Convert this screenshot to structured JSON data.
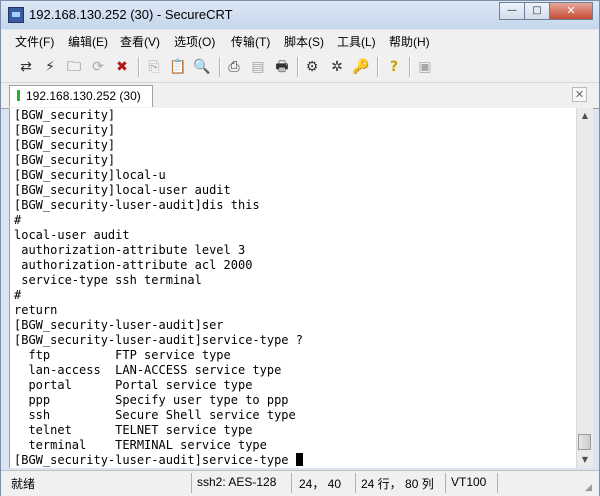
{
  "window": {
    "title": "192.168.130.252 (30) - SecureCRT",
    "buttons": {
      "minimize": "—",
      "maximize": "□",
      "close": "✕"
    }
  },
  "menu": [
    "文件(F)",
    "编辑(E)",
    "查看(V)",
    "选项(O)",
    "传输(T)",
    "脚本(S)",
    "工具(L)",
    "帮助(H)"
  ],
  "toolbar": [
    {
      "icon": "connect-icon",
      "glyph": "⇄"
    },
    {
      "icon": "quick-connect-icon",
      "glyph": "⚡"
    },
    {
      "icon": "connect-in-tab-icon",
      "glyph": "🗀"
    },
    {
      "icon": "reconnect-icon",
      "glyph": "⟳"
    },
    {
      "icon": "disconnect-icon",
      "glyph": "✖"
    },
    {
      "icon": "copy-icon",
      "glyph": "⎘"
    },
    {
      "icon": "paste-icon",
      "glyph": "📋"
    },
    {
      "icon": "find-icon",
      "glyph": "🔍"
    },
    {
      "icon": "print-setup-icon",
      "glyph": "⎙"
    },
    {
      "icon": "print-selection-icon",
      "glyph": "▤"
    },
    {
      "icon": "print-icon",
      "glyph": "🖶"
    },
    {
      "icon": "session-options-icon",
      "glyph": "⚙"
    },
    {
      "icon": "global-options-icon",
      "glyph": "✲"
    },
    {
      "icon": "keymap-icon",
      "glyph": "🔑"
    },
    {
      "icon": "help-icon",
      "glyph": "?"
    },
    {
      "icon": "sftp-icon",
      "glyph": "▣"
    }
  ],
  "tab": {
    "label": "192.168.130.252  (30)",
    "close": "✕"
  },
  "terminal_lines": [
    "[BGW_security]",
    "[BGW_security]",
    "[BGW_security]",
    "[BGW_security]",
    "[BGW_security]local-u",
    "[BGW_security]local-user audit",
    "[BGW_security-luser-audit]dis this",
    "#",
    "local-user audit",
    " authorization-attribute level 3",
    " authorization-attribute acl 2000",
    " service-type ssh terminal",
    "#",
    "return",
    "[BGW_security-luser-audit]ser",
    "[BGW_security-luser-audit]service-type ?",
    "  ftp         FTP service type",
    "  lan-access  LAN-ACCESS service type",
    "  portal      Portal service type",
    "  ppp         Specify user type to ppp",
    "  ssh         Secure Shell service type",
    "  telnet      TELNET service type",
    "  terminal    TERMINAL service type",
    "[BGW_security-luser-audit]service-type "
  ],
  "status": {
    "ready": "就绪",
    "cipher": "ssh2: AES-128",
    "cursor_pos": "24， 40",
    "size": "24 行， 80 列",
    "emulation": "VT100"
  }
}
